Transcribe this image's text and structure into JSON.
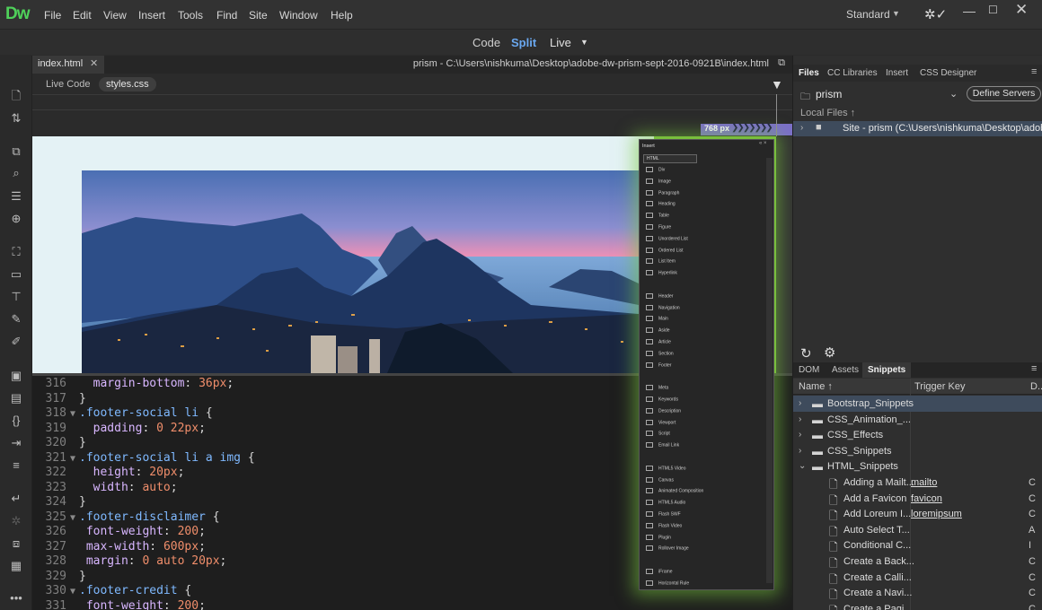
{
  "app": {
    "logo": "Dw",
    "menus": [
      "File",
      "Edit",
      "View",
      "Insert",
      "Tools",
      "Find",
      "Site",
      "Window",
      "Help"
    ],
    "workspace": "Standard",
    "window_controls": {
      "minimize": "—",
      "maximize": "☐",
      "close": "✕"
    }
  },
  "view_modes": {
    "code": "Code",
    "split": "Split",
    "live": "Live"
  },
  "document": {
    "tab": "index.html",
    "path": "prism - C:\\Users\\nishkuma\\Desktop\\adobe-dw-prism-sept-2016-0921B\\index.html",
    "related": {
      "live_code": "Live Code",
      "styles": "styles.css"
    }
  },
  "media_query": {
    "width_label": "768 px"
  },
  "code_lines": [
    {
      "n": "316",
      "fold": "",
      "parts": [
        [
          "  ",
          ""
        ],
        [
          "margin-bottom",
          "prop"
        ],
        [
          ": ",
          "pun"
        ],
        [
          "36px",
          "val"
        ],
        [
          ";",
          "pun"
        ]
      ]
    },
    {
      "n": "317",
      "fold": "",
      "parts": [
        [
          "}",
          "pun"
        ]
      ]
    },
    {
      "n": "318",
      "fold": "▼",
      "parts": [
        [
          ".footer-social li",
          "sel"
        ],
        [
          " {",
          "pun"
        ]
      ]
    },
    {
      "n": "319",
      "fold": "",
      "parts": [
        [
          "  ",
          ""
        ],
        [
          "padding",
          "prop"
        ],
        [
          ": ",
          "pun"
        ],
        [
          "0 22px",
          "val"
        ],
        [
          ";",
          "pun"
        ]
      ]
    },
    {
      "n": "320",
      "fold": "",
      "parts": [
        [
          "}",
          "pun"
        ]
      ]
    },
    {
      "n": "321",
      "fold": "▼",
      "parts": [
        [
          ".footer-social li a img",
          "sel"
        ],
        [
          " {",
          "pun"
        ]
      ]
    },
    {
      "n": "322",
      "fold": "",
      "parts": [
        [
          "  ",
          ""
        ],
        [
          "height",
          "prop"
        ],
        [
          ": ",
          "pun"
        ],
        [
          "20px",
          "val"
        ],
        [
          ";",
          "pun"
        ]
      ]
    },
    {
      "n": "323",
      "fold": "",
      "parts": [
        [
          "  ",
          ""
        ],
        [
          "width",
          "prop"
        ],
        [
          ": ",
          "pun"
        ],
        [
          "auto",
          "val"
        ],
        [
          ";",
          "pun"
        ]
      ]
    },
    {
      "n": "324",
      "fold": "",
      "parts": [
        [
          "}",
          "pun"
        ]
      ]
    },
    {
      "n": "325",
      "fold": "▼",
      "parts": [
        [
          ".footer-disclaimer",
          "sel"
        ],
        [
          " {",
          "pun"
        ]
      ]
    },
    {
      "n": "326",
      "fold": "",
      "parts": [
        [
          " ",
          ""
        ],
        [
          "font-weight",
          "prop"
        ],
        [
          ": ",
          "pun"
        ],
        [
          "200",
          "val"
        ],
        [
          ";",
          "pun"
        ]
      ]
    },
    {
      "n": "327",
      "fold": "",
      "parts": [
        [
          " ",
          ""
        ],
        [
          "max-width",
          "prop"
        ],
        [
          ": ",
          "pun"
        ],
        [
          "600px",
          "val"
        ],
        [
          ";",
          "pun"
        ]
      ]
    },
    {
      "n": "328",
      "fold": "",
      "parts": [
        [
          " ",
          ""
        ],
        [
          "margin",
          "prop"
        ],
        [
          ": ",
          "pun"
        ],
        [
          "0 auto 20px",
          "val"
        ],
        [
          ";",
          "pun"
        ]
      ]
    },
    {
      "n": "329",
      "fold": "",
      "parts": [
        [
          "}",
          "pun"
        ]
      ]
    },
    {
      "n": "330",
      "fold": "▼",
      "parts": [
        [
          ".footer-credit",
          "sel"
        ],
        [
          " {",
          "pun"
        ]
      ]
    },
    {
      "n": "331",
      "fold": "",
      "parts": [
        [
          " ",
          ""
        ],
        [
          "font-weight",
          "prop"
        ],
        [
          ": ",
          "pun"
        ],
        [
          "200",
          "val"
        ],
        [
          ";",
          "pun"
        ]
      ]
    }
  ],
  "insert_panel": {
    "title": "Insert",
    "category": "HTML",
    "items": [
      {
        "label": "Div",
        "gap": false
      },
      {
        "label": "Image",
        "gap": false
      },
      {
        "label": "Paragraph",
        "gap": false
      },
      {
        "label": "Heading",
        "gap": false
      },
      {
        "label": "Table",
        "gap": false
      },
      {
        "label": "Figure",
        "gap": false
      },
      {
        "label": "Unordered List",
        "gap": false
      },
      {
        "label": "Ordered List",
        "gap": false
      },
      {
        "label": "List Item",
        "gap": false
      },
      {
        "label": "Hyperlink",
        "gap": false
      },
      {
        "label": "Header",
        "gap": true
      },
      {
        "label": "Navigation",
        "gap": false
      },
      {
        "label": "Main",
        "gap": false
      },
      {
        "label": "Aside",
        "gap": false
      },
      {
        "label": "Article",
        "gap": false
      },
      {
        "label": "Section",
        "gap": false
      },
      {
        "label": "Footer",
        "gap": false
      },
      {
        "label": "Meta",
        "gap": true
      },
      {
        "label": "Keywords",
        "gap": false
      },
      {
        "label": "Description",
        "gap": false
      },
      {
        "label": "Viewport",
        "gap": false
      },
      {
        "label": "Script",
        "gap": false
      },
      {
        "label": "Email Link",
        "gap": false
      },
      {
        "label": "HTML5 Video",
        "gap": true
      },
      {
        "label": "Canvas",
        "gap": false
      },
      {
        "label": "Animated Composition",
        "gap": false
      },
      {
        "label": "HTML5 Audio",
        "gap": false
      },
      {
        "label": "Flash SWF",
        "gap": false
      },
      {
        "label": "Flash Video",
        "gap": false
      },
      {
        "label": "Plugin",
        "gap": false
      },
      {
        "label": "Rollover Image",
        "gap": false
      },
      {
        "label": "iFrame",
        "gap": true
      },
      {
        "label": "Horizontal Rule",
        "gap": false
      }
    ]
  },
  "files_panel": {
    "tabs": [
      "Files",
      "CC Libraries",
      "Insert",
      "CSS Designer"
    ],
    "site": "prism",
    "define_servers": "Define Servers",
    "local_files_label": "Local Files ↑",
    "site_row": "Site - prism (C:\\Users\\nishkuma\\Desktop\\adobe..."
  },
  "snippets_panel": {
    "tabs": [
      "DOM",
      "Assets",
      "Snippets"
    ],
    "columns": {
      "name": "Name ↑",
      "trigger": "Trigger Key",
      "desc": "D..."
    },
    "rows": [
      {
        "type": "folder",
        "open": false,
        "name": "Bootstrap_Snippets",
        "trigger": "",
        "desc": "",
        "selected": true
      },
      {
        "type": "folder",
        "open": false,
        "name": "CSS_Animation_...",
        "trigger": "",
        "desc": "",
        "selected": false
      },
      {
        "type": "folder",
        "open": false,
        "name": "CSS_Effects",
        "trigger": "",
        "desc": "",
        "selected": false
      },
      {
        "type": "folder",
        "open": false,
        "name": "CSS_Snippets",
        "trigger": "",
        "desc": "",
        "selected": false
      },
      {
        "type": "folder",
        "open": true,
        "name": "HTML_Snippets",
        "trigger": "",
        "desc": "",
        "selected": false
      },
      {
        "type": "file",
        "name": "Adding a Mailt...",
        "trigger": "mailto",
        "desc": "C",
        "selected": false
      },
      {
        "type": "file",
        "name": "Add a Favicon",
        "trigger": "favicon",
        "desc": "C",
        "selected": false
      },
      {
        "type": "file",
        "name": "Add Loreum I...",
        "trigger": "loremipsum",
        "desc": "C",
        "selected": false
      },
      {
        "type": "file",
        "name": "Auto Select T...",
        "trigger": "",
        "desc": "A",
        "selected": false
      },
      {
        "type": "file",
        "name": "Conditional C...",
        "trigger": "",
        "desc": "I",
        "selected": false
      },
      {
        "type": "file",
        "name": "Create a Back...",
        "trigger": "",
        "desc": "C",
        "selected": false
      },
      {
        "type": "file",
        "name": "Create a Calli...",
        "trigger": "",
        "desc": "C",
        "selected": false
      },
      {
        "type": "file",
        "name": "Create a Navi...",
        "trigger": "",
        "desc": "C",
        "selected": false
      },
      {
        "type": "file",
        "name": "Create a Pagi...",
        "trigger": "",
        "desc": "C",
        "selected": false
      }
    ]
  },
  "colors": {
    "accent": "#4fd15a",
    "split_active": "#6aa8f0",
    "media_query": "#7b6fc9",
    "selection": "#3e4b5c"
  }
}
